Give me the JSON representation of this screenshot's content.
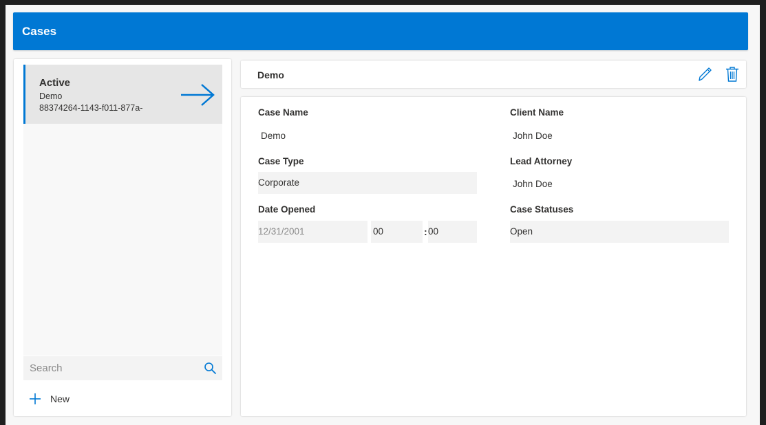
{
  "header": {
    "title": "Cases"
  },
  "sidebar": {
    "items": [
      {
        "status": "Active",
        "name": "Demo",
        "id": "88374264-1143-f011-877a-"
      }
    ],
    "search": {
      "placeholder": "Search"
    },
    "new_label": "New"
  },
  "detail": {
    "title": "Demo",
    "form": {
      "case_name_label": "Case Name",
      "case_name_value": "Demo",
      "client_name_label": "Client Name",
      "client_name_value": "John Doe",
      "case_type_label": "Case Type",
      "case_type_value": "Corporate",
      "lead_attorney_label": "Lead Attorney",
      "lead_attorney_value": "John Doe",
      "date_opened_label": "Date Opened",
      "date_opened_value": "12/31/2001",
      "hour_value": "00",
      "time_separator": ":",
      "minute_value": "00",
      "case_statuses_label": "Case Statuses",
      "case_statuses_value": "Open"
    }
  },
  "colors": {
    "accent": "#0078d4",
    "field_bg": "#f3f3f3",
    "selected_bg": "#e6e6e6"
  },
  "icons": [
    "arrow-right-icon",
    "search-icon",
    "plus-icon",
    "pencil-icon",
    "trash-icon"
  ]
}
